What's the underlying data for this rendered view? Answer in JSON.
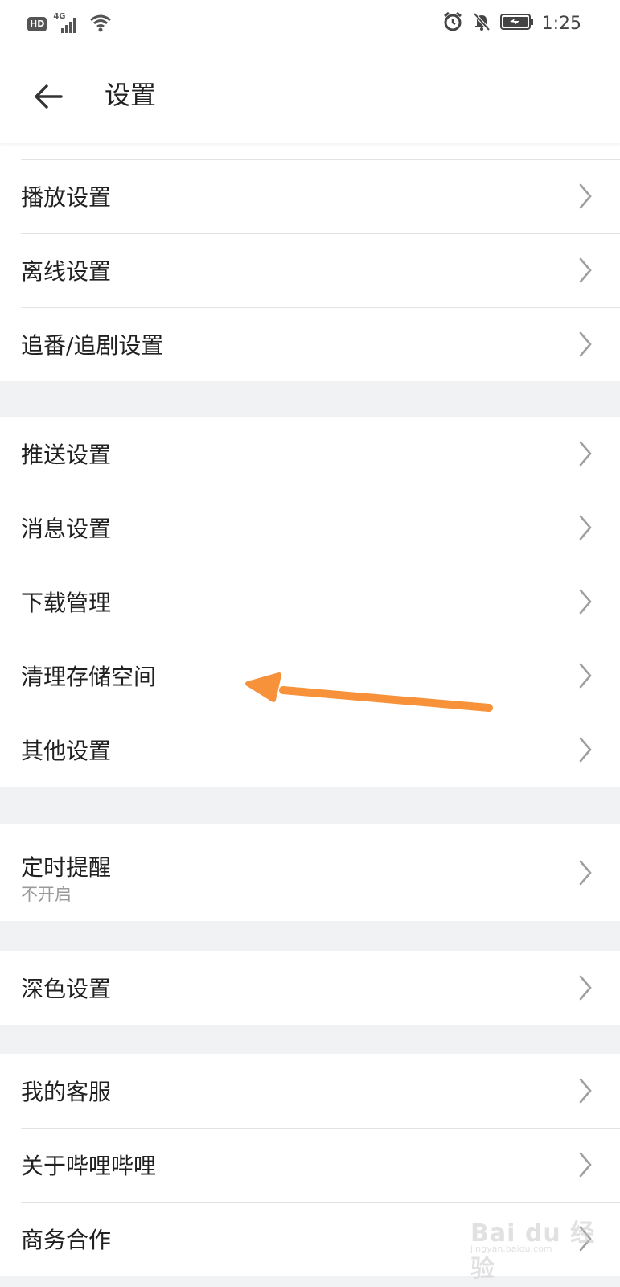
{
  "status_bar": {
    "hd": "HD",
    "network": "4G",
    "time": "1:25",
    "icons": [
      "hd-icon",
      "signal-icon",
      "wifi-icon",
      "alarm-icon",
      "mute-icon",
      "battery-charging-icon"
    ]
  },
  "header": {
    "back_icon": "arrow-left-icon",
    "title": "设置"
  },
  "groups": [
    {
      "items": [
        {
          "label": "播放设置"
        },
        {
          "label": "离线设置"
        },
        {
          "label": "追番/追剧设置"
        }
      ]
    },
    {
      "items": [
        {
          "label": "推送设置"
        },
        {
          "label": "消息设置"
        },
        {
          "label": "下载管理"
        },
        {
          "label": "清理存储空间"
        },
        {
          "label": "其他设置"
        }
      ]
    },
    {
      "items": [
        {
          "label": "定时提醒",
          "sub": "不开启"
        }
      ]
    },
    {
      "items": [
        {
          "label": "深色设置"
        }
      ]
    },
    {
      "items": [
        {
          "label": "我的客服"
        },
        {
          "label": "关于哔哩哔哩"
        },
        {
          "label": "商务合作"
        }
      ]
    }
  ],
  "annotation": {
    "color": "#f7923a",
    "points_to": "清理存储空间"
  },
  "watermark": {
    "main": "Bai du 经验",
    "sub": "jingyan.baidu.com"
  },
  "colors": {
    "background": "#f1f2f4",
    "surface": "#ffffff",
    "divider": "#e2e2e2",
    "chevron": "#9e9e9e",
    "subtext": "#9a9a9a"
  }
}
